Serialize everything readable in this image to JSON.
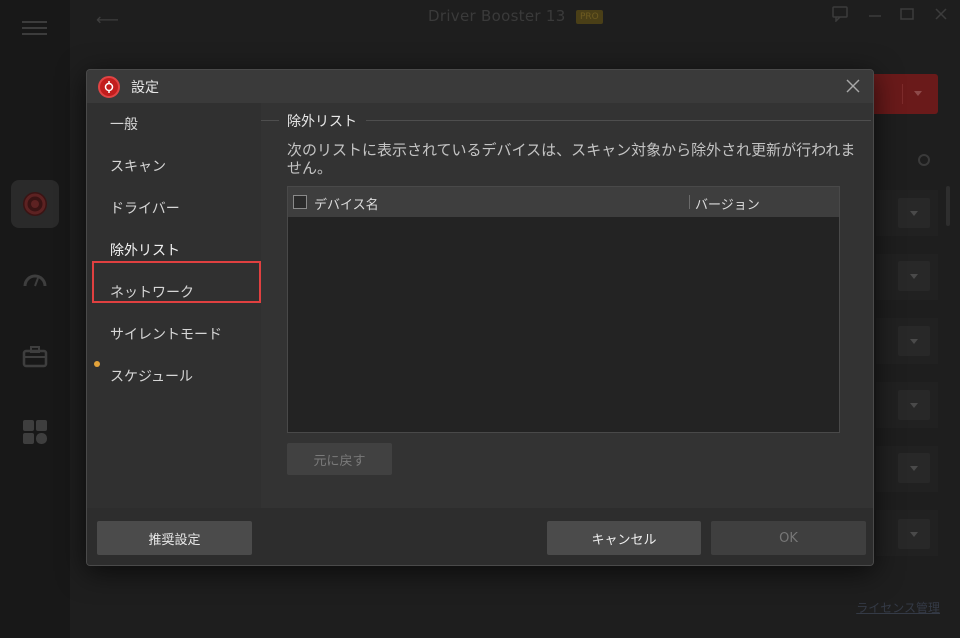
{
  "app": {
    "title": "Driver Booster 13",
    "pro_badge": "PRO",
    "license_link": "ライセンス管理"
  },
  "dialog": {
    "title": "設定",
    "nav": [
      {
        "label": "一般"
      },
      {
        "label": "スキャン"
      },
      {
        "label": "ドライバー"
      },
      {
        "label": "除外リスト"
      },
      {
        "label": "ネットワーク"
      },
      {
        "label": "サイレントモード"
      },
      {
        "label": "スケジュール"
      }
    ],
    "active_nav": "除外リスト",
    "section_title": "除外リスト",
    "description": "次のリストに表示されているデバイスは、スキャン対象から除外され更新が行われません。",
    "table": {
      "columns": [
        "デバイス名",
        "バージョン"
      ],
      "rows": []
    },
    "restore_button": "元に戻す",
    "footer": {
      "recommended": "推奨設定",
      "cancel": "キャンセル",
      "ok": "OK"
    }
  },
  "colors": {
    "highlight": "#e04040",
    "accent_dot": "#e3a33a",
    "brand_red": "#c21d1d"
  }
}
